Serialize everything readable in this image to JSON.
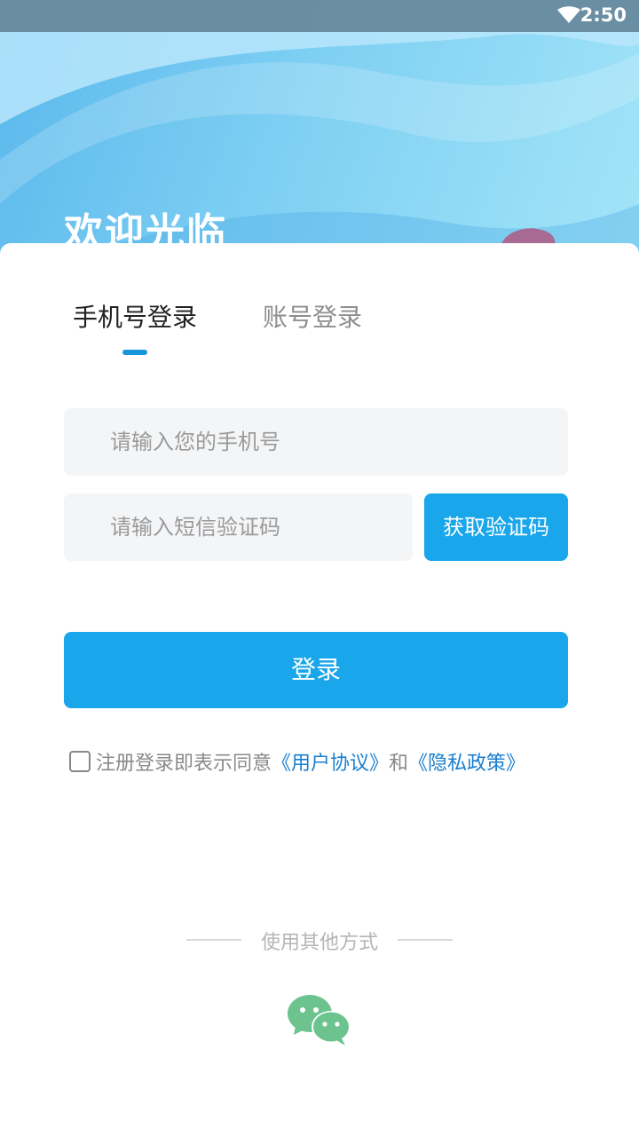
{
  "status": {
    "time": "2:50",
    "wifi_icon": "wifi-icon"
  },
  "header": {
    "welcome": "欢迎光临"
  },
  "tabs": [
    {
      "label": "手机号登录",
      "active": true
    },
    {
      "label": "账号登录",
      "active": false
    }
  ],
  "form": {
    "phone_placeholder": "请输入您的手机号",
    "code_placeholder": "请输入短信验证码",
    "get_code_label": "获取验证码",
    "login_label": "登录"
  },
  "agreement": {
    "checked": false,
    "text": "注册登录即表示同意",
    "user_agreement": "《用户协议》",
    "and": "和",
    "privacy_policy": "《隐私政策》"
  },
  "other_login": {
    "label": "使用其他方式",
    "wechat_icon": "wechat-icon"
  },
  "colors": {
    "accent": "#19a6ea",
    "link": "#1a7fcf",
    "wechat": "#6cc38e"
  }
}
